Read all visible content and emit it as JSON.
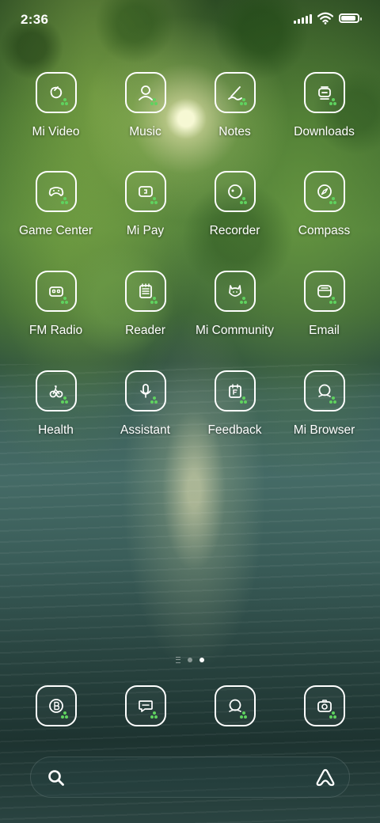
{
  "status_bar": {
    "time": "2:36",
    "battery_level": 1.0,
    "icons": [
      "signal-icon",
      "wifi-icon",
      "battery-icon"
    ]
  },
  "apps": [
    {
      "label": "Mi Video",
      "icon": "mi-video-icon"
    },
    {
      "label": "Music",
      "icon": "music-icon"
    },
    {
      "label": "Notes",
      "icon": "notes-icon"
    },
    {
      "label": "Downloads",
      "icon": "downloads-icon"
    },
    {
      "label": "Game Center",
      "icon": "game-center-icon"
    },
    {
      "label": "Mi Pay",
      "icon": "mi-pay-icon"
    },
    {
      "label": "Recorder",
      "icon": "recorder-icon"
    },
    {
      "label": "Compass",
      "icon": "compass-icon"
    },
    {
      "label": "FM Radio",
      "icon": "fm-radio-icon"
    },
    {
      "label": "Reader",
      "icon": "reader-icon"
    },
    {
      "label": "Mi Community",
      "icon": "mi-community-icon"
    },
    {
      "label": "Email",
      "icon": "email-icon"
    },
    {
      "label": "Health",
      "icon": "health-icon"
    },
    {
      "label": "Assistant",
      "icon": "assistant-icon"
    },
    {
      "label": "Feedback",
      "icon": "feedback-icon"
    },
    {
      "label": "Mi Browser",
      "icon": "mi-browser-icon"
    }
  ],
  "page_indicator": {
    "pages": 2,
    "active": 2
  },
  "dock": [
    {
      "icon": "security-icon"
    },
    {
      "icon": "messages-icon"
    },
    {
      "icon": "browser-icon"
    },
    {
      "icon": "camera-icon"
    }
  ],
  "search_bar": {
    "icons": [
      "search-icon",
      "assistant-logo-icon"
    ]
  },
  "colors": {
    "icon_dot": "#5fd35f",
    "foreground": "#ffffff"
  }
}
